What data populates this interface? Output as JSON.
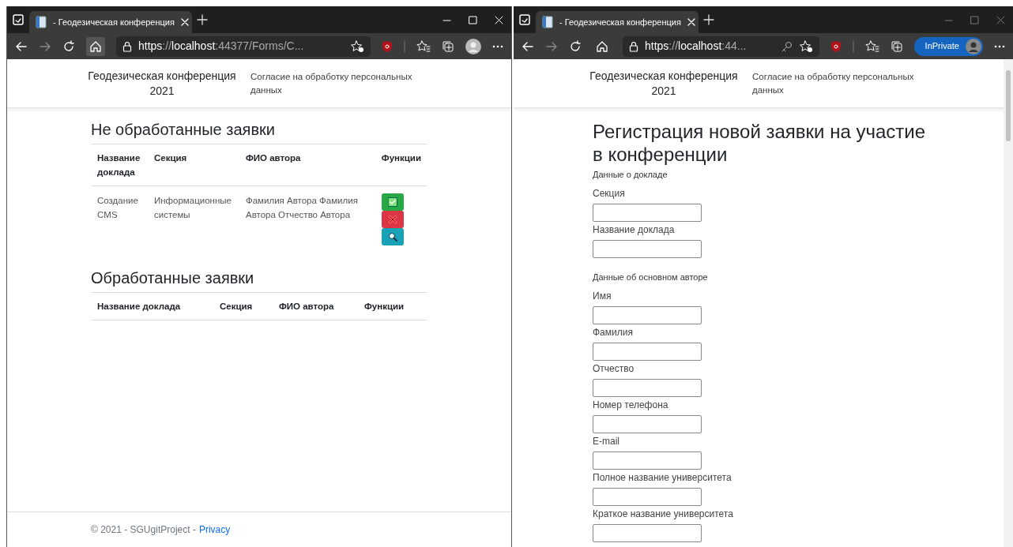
{
  "windows": [
    {
      "focused": true,
      "tab": {
        "title": "- Геодезическая конференция"
      },
      "address": {
        "scheme": "https",
        "separator": "://",
        "host": "localhost",
        "rest": ":44377/Forms/C..."
      },
      "page": {
        "brand": "Геодезическая конференция 2021",
        "nav_link": "Согласие на обработку персональных данных",
        "sections": [
          {
            "heading": "Не обработанные заявки",
            "columns": [
              "Название доклада",
              "Секция",
              "ФИО автора",
              "Функции"
            ],
            "rows": [
              {
                "cells": [
                  "Создание CMS",
                  "Информационные системы",
                  "Фамилия Автора Фамилия Автора Отчество Автора"
                ],
                "actions": [
                  {
                    "kind": "approve"
                  },
                  {
                    "kind": "reject"
                  },
                  {
                    "kind": "view"
                  }
                ]
              }
            ]
          },
          {
            "heading": "Обработанные заявки",
            "columns": [
              "Название доклада",
              "Секция",
              "ФИО автора",
              "Функции"
            ]
          }
        ],
        "footer": {
          "text": "© 2021 - SGUgitProject - ",
          "link": "Privacy"
        }
      }
    },
    {
      "focused": false,
      "tab": {
        "title": "- Геодезическая конференция"
      },
      "address": {
        "scheme": "https",
        "separator": "://",
        "host": "localhost",
        "rest": ":44..."
      },
      "inprivate": "InPrivate",
      "page": {
        "brand": "Геодезическая конференция 2021",
        "nav_link": "Согласие на обработку персональных данных",
        "heading": "Регистрация новой заявки на участие в конференции",
        "form": [
          {
            "kind": "section",
            "label": "Данные о докладе"
          },
          {
            "kind": "field",
            "label": "Секция"
          },
          {
            "kind": "field",
            "label": "Название доклада"
          },
          {
            "kind": "section",
            "label": "Данные об основном авторе"
          },
          {
            "kind": "field",
            "label": "Имя"
          },
          {
            "kind": "field",
            "label": "Фамилия"
          },
          {
            "kind": "field",
            "label": "Отчество"
          },
          {
            "kind": "field",
            "label": "Номер телефона"
          },
          {
            "kind": "field",
            "label": "E-mail"
          },
          {
            "kind": "field",
            "label": "Полное название университета"
          },
          {
            "kind": "field",
            "label": "Краткое название университета"
          }
        ]
      }
    }
  ]
}
